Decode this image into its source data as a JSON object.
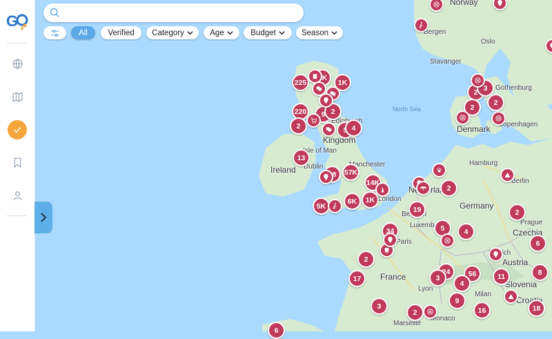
{
  "app": {
    "logo_text": "G"
  },
  "sidebar": {
    "items": [
      {
        "name": "globe",
        "icon": "globe-icon"
      },
      {
        "name": "map",
        "icon": "map-icon"
      },
      {
        "name": "checklist",
        "icon": "check-icon",
        "active": true
      },
      {
        "name": "saved",
        "icon": "bookmark-icon"
      },
      {
        "name": "profile",
        "icon": "user-icon"
      }
    ]
  },
  "search": {
    "placeholder": "",
    "value": ""
  },
  "filters": {
    "all": "All",
    "verified": "Verified",
    "category": "Category",
    "age": "Age",
    "budget": "Budget",
    "season": "Season"
  },
  "colors": {
    "accent": "#5aa9e6",
    "marker": "#c03a5a",
    "active_nav": "#f5a53a",
    "water": "#aadaff",
    "land": "#d7ebd0"
  },
  "map_labels": {
    "norway": "Norway",
    "bergen": "Bergen",
    "oslo": "Oslo",
    "stavanger": "Stavanger",
    "gothenburg": "Gothenburg",
    "north_sea": "North Sea",
    "edinburgh": "Edinburgh",
    "kingdom": "Kingdom",
    "isle_of_man": "Isle of Man",
    "ireland": "Ireland",
    "dublin": "Dublin",
    "manchester": "Manchester",
    "london": "London",
    "denmark": "Denmark",
    "copenhagen": "Copenhagen",
    "hamburg": "Hamburg",
    "berlin": "Berlin",
    "netherlands": "Netherlands",
    "germany": "Germany",
    "belgium": "Belgium",
    "luxembourg": "Luxembourg",
    "paris": "Paris",
    "prague": "Prague",
    "czechia": "Czechia",
    "munich": "Munich",
    "austria": "Austria",
    "france": "France",
    "lyon": "Lyon",
    "milan": "Milan",
    "slovenia": "Slovenia",
    "croatia": "Croatia",
    "monaco": "Monaco",
    "marseille": "Marseille"
  },
  "markers": [
    {
      "label": "225"
    },
    {
      "label": "1K"
    },
    {
      "label": "1K"
    },
    {
      "label": "220"
    },
    {
      "label": "2"
    },
    {
      "label": "9"
    },
    {
      "label": "2"
    },
    {
      "label": "5"
    },
    {
      "label": "4"
    },
    {
      "label": "13"
    },
    {
      "label": "18"
    },
    {
      "label": "57K"
    },
    {
      "label": "14K"
    },
    {
      "label": "5K"
    },
    {
      "label": "6K"
    },
    {
      "label": "1K"
    },
    {
      "label": "2"
    },
    {
      "label": "19"
    },
    {
      "label": "5"
    },
    {
      "label": "4"
    },
    {
      "label": "34"
    },
    {
      "label": "2"
    },
    {
      "label": "17"
    },
    {
      "label": "3"
    },
    {
      "label": "24"
    },
    {
      "label": "56"
    },
    {
      "label": "3"
    },
    {
      "label": "4"
    },
    {
      "label": "9"
    },
    {
      "label": "11"
    },
    {
      "label": "16"
    },
    {
      "label": "2"
    },
    {
      "label": "2"
    },
    {
      "label": "3"
    },
    {
      "label": "2"
    },
    {
      "label": "2"
    },
    {
      "label": "2"
    },
    {
      "label": "6"
    },
    {
      "label": "8"
    },
    {
      "label": "18"
    },
    {
      "label": "6"
    }
  ]
}
